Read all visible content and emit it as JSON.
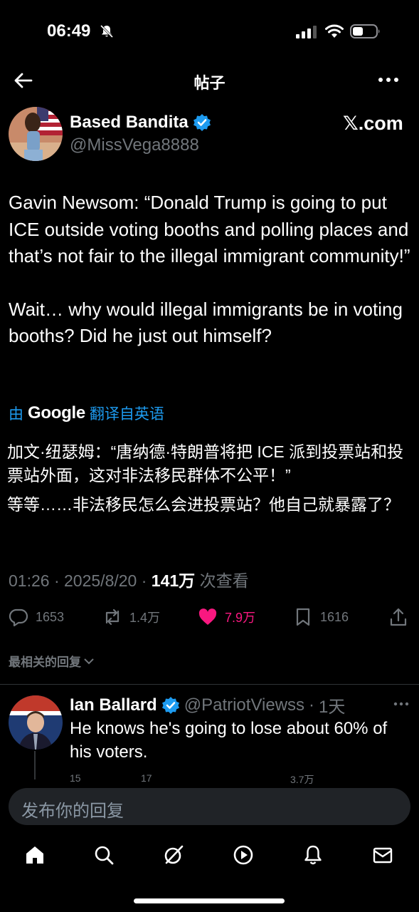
{
  "status": {
    "time": "06:49"
  },
  "header": {
    "title": "帖子"
  },
  "author": {
    "name": "Based Bandita",
    "handle": "@MissVega8888",
    "source": "𝕏.com"
  },
  "tweet": {
    "paragraphs": [
      "Gavin Newsom: “Donald Trump is going to put ICE outside voting booths and polling places and that’s not fair to the illegal immigrant community!”",
      "Wait… why would illegal immigrants be in voting booths?  Did he just out himself?"
    ]
  },
  "translation": {
    "by": "由",
    "google": "Google",
    "label": "翻译自英语",
    "paragraphs": [
      "加文·纽瑟姆：“唐纳德·特朗普将把 ICE 派到投票站和投票站外面，这对非法移民群体不公平！”",
      "等等……非法移民怎么会进投票站？他自己就暴露了？"
    ]
  },
  "meta": {
    "time": "01:26",
    "date": "2025/8/20",
    "views": "141万",
    "views_label": "次查看",
    "separator": "·"
  },
  "actions": {
    "replies": "1653",
    "reposts": "1.4万",
    "likes": "7.9万",
    "bookmarks": "1616"
  },
  "replies_sort": "最相关的回复",
  "reply": {
    "name": "Ian Ballard",
    "handle": "@PatriotViewss",
    "dot": "·",
    "age": "1天",
    "text": "He knows he's going to lose about 60% of his voters.",
    "replies": "15",
    "reposts": "17",
    "views": "3.7万"
  },
  "compose": {
    "placeholder": "发布你的回复"
  },
  "colors": {
    "accent": "#1d9bf0",
    "like": "#f91880",
    "muted": "#71767b",
    "background": "#000000"
  },
  "icons": [
    "back-arrow-icon",
    "more-icon",
    "verified-icon",
    "reply-icon",
    "repost-icon",
    "heart-icon",
    "bookmark-icon",
    "share-icon",
    "home-icon",
    "search-icon",
    "grok-icon",
    "video-icon",
    "notifications-icon",
    "messages-icon"
  ]
}
